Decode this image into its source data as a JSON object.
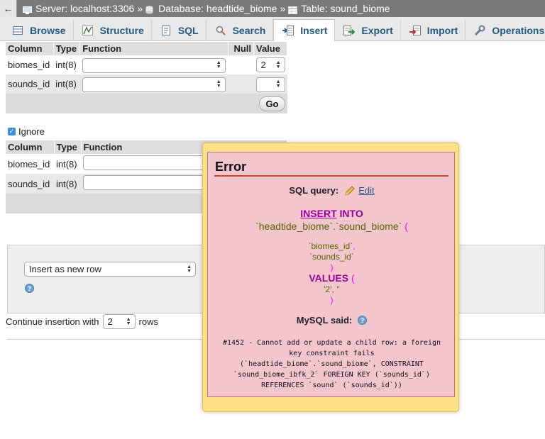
{
  "breadcrumb": {
    "back": "←",
    "server": "Server: localhost:3306",
    "database": "Database: headtide_biome",
    "table": "Table: sound_biome",
    "separator": "»"
  },
  "tabs": [
    {
      "label": "Browse",
      "icon": "browse-icon"
    },
    {
      "label": "Structure",
      "icon": "structure-icon"
    },
    {
      "label": "SQL",
      "icon": "sql-icon"
    },
    {
      "label": "Search",
      "icon": "search-icon"
    },
    {
      "label": "Insert",
      "icon": "insert-icon",
      "active": true
    },
    {
      "label": "Export",
      "icon": "export-icon"
    },
    {
      "label": "Import",
      "icon": "import-icon"
    },
    {
      "label": "Operations",
      "icon": "operations-icon"
    }
  ],
  "form1": {
    "headers": {
      "column": "Column",
      "type": "Type",
      "function": "Function",
      "null": "Null",
      "value": "Value"
    },
    "rows": [
      {
        "column": "biomes_id",
        "type": "int(8)",
        "function": "",
        "value": "2"
      },
      {
        "column": "sounds_id",
        "type": "int(8)",
        "function": "",
        "value": ""
      }
    ],
    "go_label": "Go"
  },
  "ignore": {
    "label": "Ignore",
    "checked": true
  },
  "form2": {
    "headers": {
      "column": "Column",
      "type": "Type",
      "function": "Function"
    },
    "rows": [
      {
        "column": "biomes_id",
        "type": "int(8)"
      },
      {
        "column": "sounds_id",
        "type": "int(8)"
      }
    ]
  },
  "insert_mode": {
    "selected": "Insert as new row"
  },
  "continue_insertion": {
    "prefix": "Continue insertion with",
    "value": "2",
    "suffix": "rows"
  },
  "error": {
    "title": "Error",
    "sql_query_label": "SQL query:",
    "edit_label": "Edit",
    "query": {
      "insert": "INSERT",
      "into": "INTO",
      "table": "`headtide_biome`.`sound_biome`",
      "open_paren": "(",
      "col1": "`biomes_id`",
      "comma": ",",
      "col2": "`sounds_id`",
      "close_paren": ")",
      "values": "VALUES",
      "vals": "'2', ''"
    },
    "mysql_said_label": "MySQL said:",
    "message_lines": [
      "#1452 - Cannot add or update a child row: a foreign",
      "key constraint fails",
      "(`headtide_biome`.`sound_biome`, CONSTRAINT",
      "`sound_biome_ibfk_2` FOREIGN KEY (`sounds_id`)",
      "REFERENCES `sound` (`sounds_id`))"
    ]
  },
  "colors": {
    "accent": "#235a81",
    "error_bg": "#f3c6cd",
    "popup_bg": "#fde184",
    "error_line": "#d3403a",
    "keyword": "#990099",
    "string": "#556600",
    "paren": "#ff00ff"
  }
}
